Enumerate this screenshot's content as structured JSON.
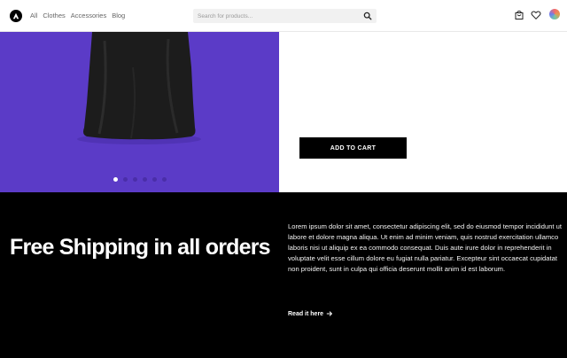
{
  "nav": {
    "items": [
      "All",
      "Clothes",
      "Accessories",
      "Blog"
    ]
  },
  "search": {
    "placeholder": "Search for products..."
  },
  "product": {
    "add_to_cart": "ADD TO CART",
    "slide_count": 6,
    "active_slide": 1
  },
  "promo": {
    "title": "Free Shipping in all orders",
    "body": "Lorem ipsum dolor sit amet, consectetur adipiscing elit, sed do eiusmod tempor incididunt ut labore et dolore magna aliqua. Ut enim ad minim veniam, quis nostrud exercitation ullamco laboris nisi ut aliquip ex ea commodo consequat. Duis aute irure dolor in reprehenderit in voluptate velit esse cillum dolore eu fugiat nulla pariatur. Excepteur sint occaecat cupidatat non proident, sunt in culpa qui officia deserunt mollit anim id est laborum.",
    "read_more": "Read it here"
  },
  "colors": {
    "hero_bg": "#5b3bc7",
    "promo_bg": "#000000",
    "button_bg": "#000000"
  }
}
